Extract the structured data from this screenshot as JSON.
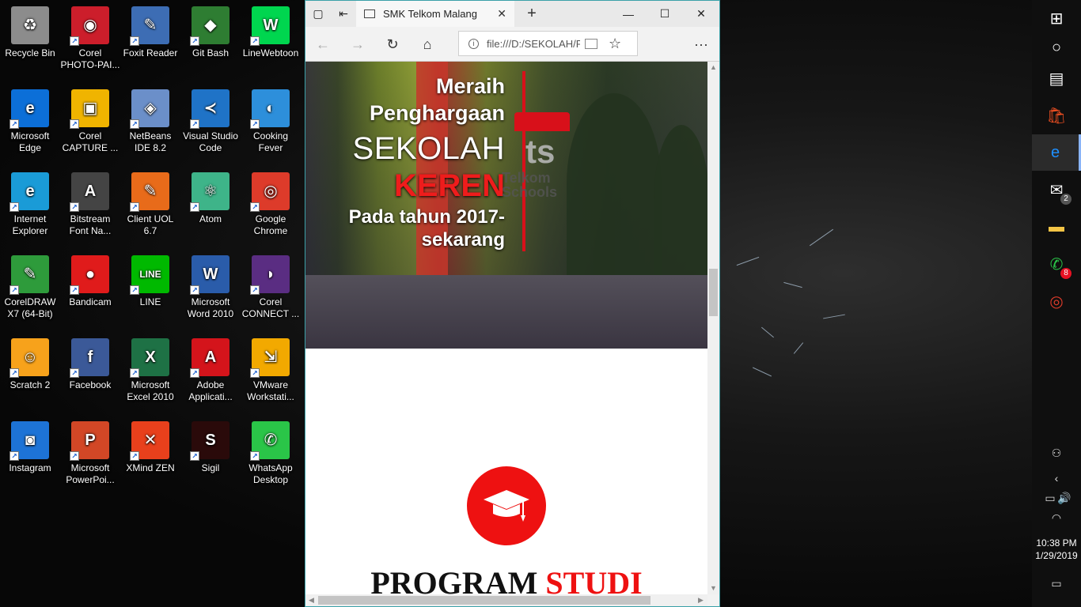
{
  "desktop": {
    "icons": [
      {
        "name": "recycle-bin",
        "label": "Recycle Bin",
        "color": "#8c8c8c",
        "glyph": "♻"
      },
      {
        "name": "corel-photo-paint",
        "label": "Corel PHOTO-PAI...",
        "color": "#cc1e2b",
        "glyph": "◉"
      },
      {
        "name": "foxit-reader",
        "label": "Foxit Reader",
        "color": "#3d6db4",
        "glyph": "✎"
      },
      {
        "name": "git-bash",
        "label": "Git Bash",
        "color": "#2e7d32",
        "glyph": "◆"
      },
      {
        "name": "linewebtoon",
        "label": "LineWebtoon",
        "color": "#00d64f",
        "glyph": "W"
      },
      {
        "name": "microsoft-edge",
        "label": "Microsoft Edge",
        "color": "#0c6fd8",
        "glyph": "e"
      },
      {
        "name": "corel-capture",
        "label": "Corel CAPTURE ...",
        "color": "#f0b400",
        "glyph": "▣"
      },
      {
        "name": "netbeans",
        "label": "NetBeans IDE 8.2",
        "color": "#6b8fc9",
        "glyph": "◈"
      },
      {
        "name": "visual-studio-code",
        "label": "Visual Studio Code",
        "color": "#1f73c7",
        "glyph": "≺"
      },
      {
        "name": "cooking-fever",
        "label": "Cooking Fever",
        "color": "#2d8fdb",
        "glyph": "◐"
      },
      {
        "name": "internet-explorer",
        "label": "Internet Explorer",
        "color": "#1a9bd7",
        "glyph": "e"
      },
      {
        "name": "bitstream-font-navigator",
        "label": "Bitstream Font Na...",
        "color": "#444444",
        "glyph": "A"
      },
      {
        "name": "client-uol",
        "label": "Client UOL 6.7",
        "color": "#e86b1a",
        "glyph": "✎"
      },
      {
        "name": "atom",
        "label": "Atom",
        "color": "#3eb489",
        "glyph": "⚛"
      },
      {
        "name": "google-chrome",
        "label": "Google Chrome",
        "color": "#dd3b2a",
        "glyph": "◎"
      },
      {
        "name": "coreldraw",
        "label": "CorelDRAW X7 (64-Bit)",
        "color": "#2e9b3b",
        "glyph": "✎"
      },
      {
        "name": "bandicam",
        "label": "Bandicam",
        "color": "#e01b1b",
        "glyph": "●"
      },
      {
        "name": "line",
        "label": "LINE",
        "color": "#00b900",
        "glyph": "LINE"
      },
      {
        "name": "microsoft-word",
        "label": "Microsoft Word 2010",
        "color": "#2a5caa",
        "glyph": "W"
      },
      {
        "name": "corel-connect",
        "label": "Corel CONNECT ...",
        "color": "#5a2d82",
        "glyph": "◗"
      },
      {
        "name": "scratch",
        "label": "Scratch 2",
        "color": "#f7a21b",
        "glyph": "☺"
      },
      {
        "name": "facebook",
        "label": "Facebook",
        "color": "#3b5998",
        "glyph": "f"
      },
      {
        "name": "microsoft-excel",
        "label": "Microsoft Excel 2010",
        "color": "#1e7145",
        "glyph": "X"
      },
      {
        "name": "adobe-application-manager",
        "label": "Adobe Applicati...",
        "color": "#d4141b",
        "glyph": "A"
      },
      {
        "name": "vmware-workstation",
        "label": "VMware Workstati...",
        "color": "#f2a900",
        "glyph": "⇲"
      },
      {
        "name": "instagram",
        "label": "Instagram",
        "color": "#1d73d6",
        "glyph": "◙"
      },
      {
        "name": "microsoft-powerpoint",
        "label": "Microsoft PowerPoi...",
        "color": "#d24726",
        "glyph": "P"
      },
      {
        "name": "xmind-zen",
        "label": "XMind ZEN",
        "color": "#e8401c",
        "glyph": "✕"
      },
      {
        "name": "sigil",
        "label": "Sigil",
        "color": "#2a0a0a",
        "glyph": "S"
      },
      {
        "name": "whatsapp-desktop",
        "label": "WhatsApp Desktop",
        "color": "#2ac548",
        "glyph": "✆"
      }
    ]
  },
  "browser": {
    "tab_title": "SMK Telkom Malang",
    "address_url": "file:///D:/SEKOLAH/P",
    "icons": {
      "set-aside": "▢",
      "tab-preview": "⇤",
      "close": "✕",
      "new-tab": "+",
      "minimize": "—",
      "maximize": "☐",
      "window-close": "✕",
      "back": "←",
      "forward": "→",
      "refresh": "↻",
      "home": "⌂",
      "info": "i",
      "favorite": "☆",
      "more": "···"
    },
    "page": {
      "hero": {
        "line1": "Meraih",
        "line2": "Penghargaan",
        "line3": "SEKOLAH",
        "line4": "KEREN",
        "line5a": "Pada tahun 2017-",
        "line5b": "sekarang",
        "logo_letter": "ts",
        "logo_brand_1": "Telkom",
        "logo_brand_2": "Schools"
      },
      "section_title_black": "PROGRAM",
      "section_title_red": "STUDI",
      "accent_red": "#ee1111"
    }
  },
  "taskbar": {
    "items": [
      {
        "name": "start",
        "glyph": "⊞",
        "top": 0
      },
      {
        "name": "cortana",
        "glyph": "○"
      },
      {
        "name": "task-view",
        "glyph": "▤"
      },
      {
        "name": "microsoft-store",
        "glyph": "🛍"
      },
      {
        "name": "edge",
        "glyph": "e"
      },
      {
        "name": "mail",
        "glyph": "✉",
        "badge": "2"
      },
      {
        "name": "file-explorer",
        "glyph": "▬"
      },
      {
        "name": "whatsapp",
        "glyph": "✆",
        "badge": "8"
      },
      {
        "name": "chrome",
        "glyph": "◎"
      }
    ],
    "time": "10:38 PM",
    "date": "1/29/2019",
    "tray_icons": {
      "people": "⚇",
      "show-hidden": "‹",
      "battery": "▭",
      "volume": "🔊",
      "network": "◠",
      "action-center": "▭"
    }
  }
}
